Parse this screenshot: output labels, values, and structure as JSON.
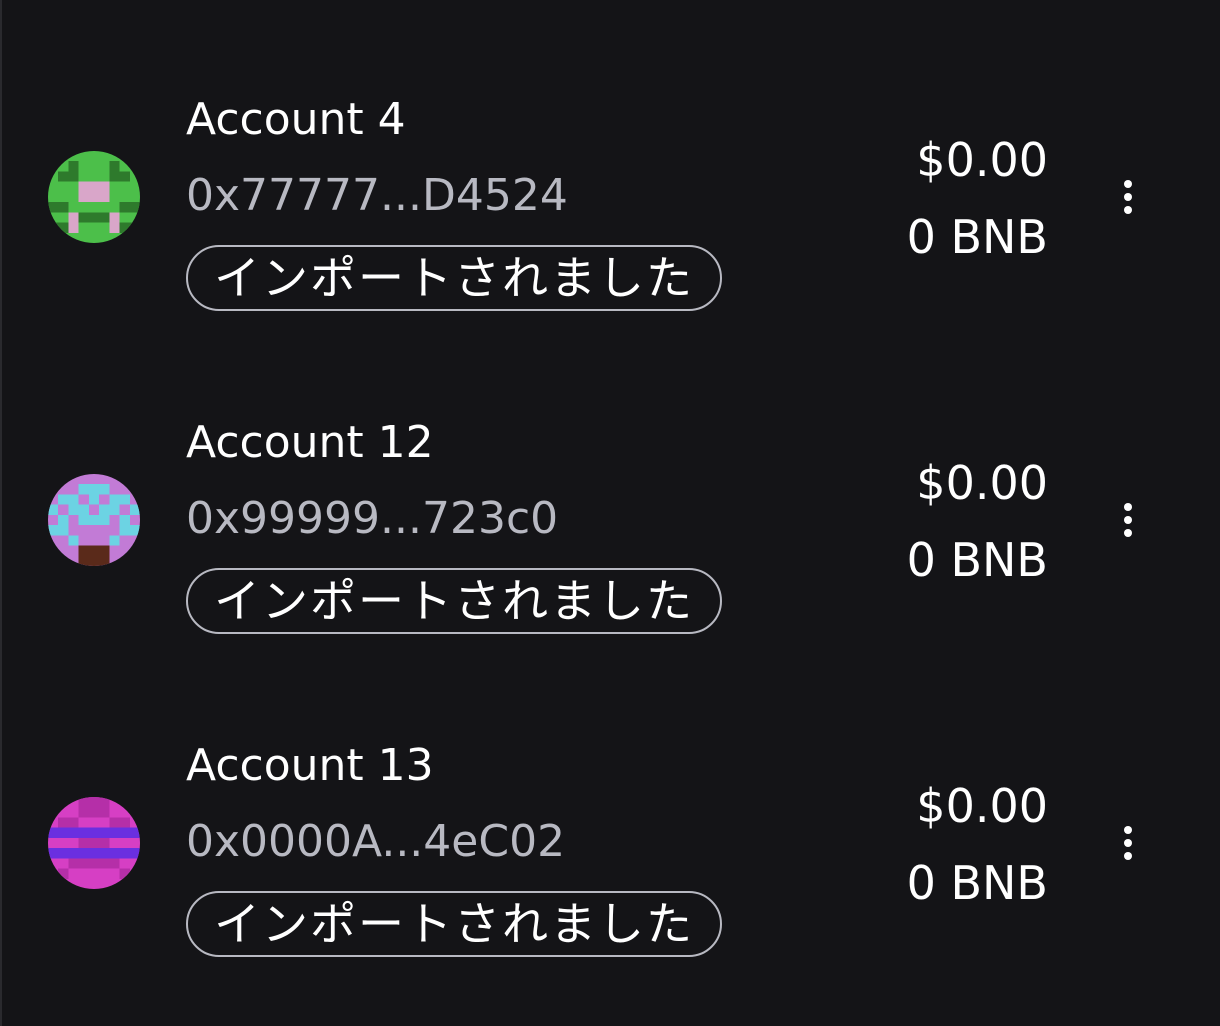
{
  "accounts": [
    {
      "name": "Account 4",
      "address": "0x77777...D4524",
      "badge": "インポートされました",
      "fiat_balance": "$0.00",
      "token_balance": "0 BNB",
      "avatar_colors": [
        "#4cbf4a",
        "#2e7a2c",
        "#d9a6c9"
      ]
    },
    {
      "name": "Account 12",
      "address": "0x99999...723c0",
      "badge": "インポートされました",
      "fiat_balance": "$0.00",
      "token_balance": "0 BNB",
      "avatar_colors": [
        "#c27bd6",
        "#6cd3e3",
        "#5a2a1a"
      ]
    },
    {
      "name": "Account 13",
      "address": "0x0000A...4eC02",
      "badge": "インポートされました",
      "fiat_balance": "$0.00",
      "token_balance": "0 BNB",
      "avatar_colors": [
        "#d63fc4",
        "#b52fa8",
        "#6a2fe0"
      ]
    }
  ],
  "icons": {
    "menu": "kebab-menu-icon",
    "avatar": "identicon-avatar"
  }
}
